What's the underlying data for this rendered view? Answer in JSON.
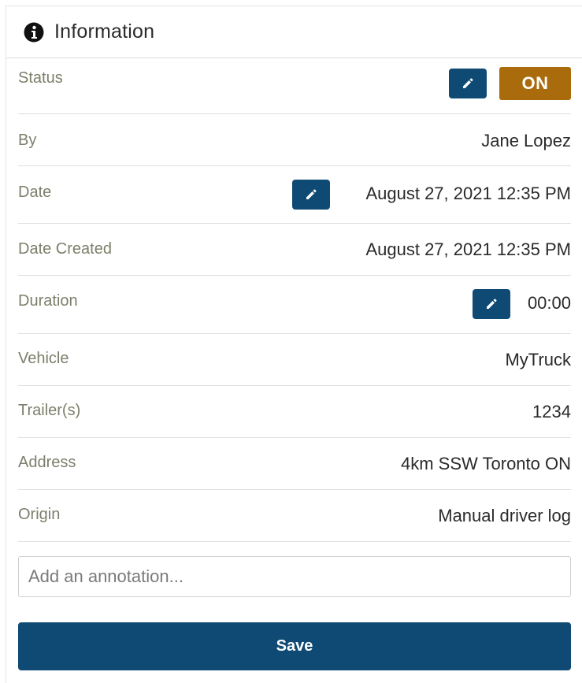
{
  "header": {
    "title": "Information",
    "icon": "info-circle-icon"
  },
  "rows": {
    "status": {
      "label": "Status",
      "value": "ON",
      "badge_color": "#aa6b0d"
    },
    "by": {
      "label": "By",
      "value": "Jane Lopez"
    },
    "date": {
      "label": "Date",
      "value": "August 27, 2021 12:35 PM"
    },
    "date_created": {
      "label": "Date Created",
      "value": "August 27, 2021 12:35 PM"
    },
    "duration": {
      "label": "Duration",
      "value": "00:00"
    },
    "vehicle": {
      "label": "Vehicle",
      "value": "MyTruck"
    },
    "trailers": {
      "label": "Trailer(s)",
      "value": "1234"
    },
    "address": {
      "label": "Address",
      "value": "4km SSW Toronto ON"
    },
    "origin": {
      "label": "Origin",
      "value": "Manual driver log"
    }
  },
  "annotation": {
    "placeholder": "Add an annotation...",
    "value": ""
  },
  "actions": {
    "save_label": "Save"
  },
  "colors": {
    "primary": "#0e4a73",
    "status_on": "#aa6b0d",
    "label": "#7b7f6a"
  }
}
